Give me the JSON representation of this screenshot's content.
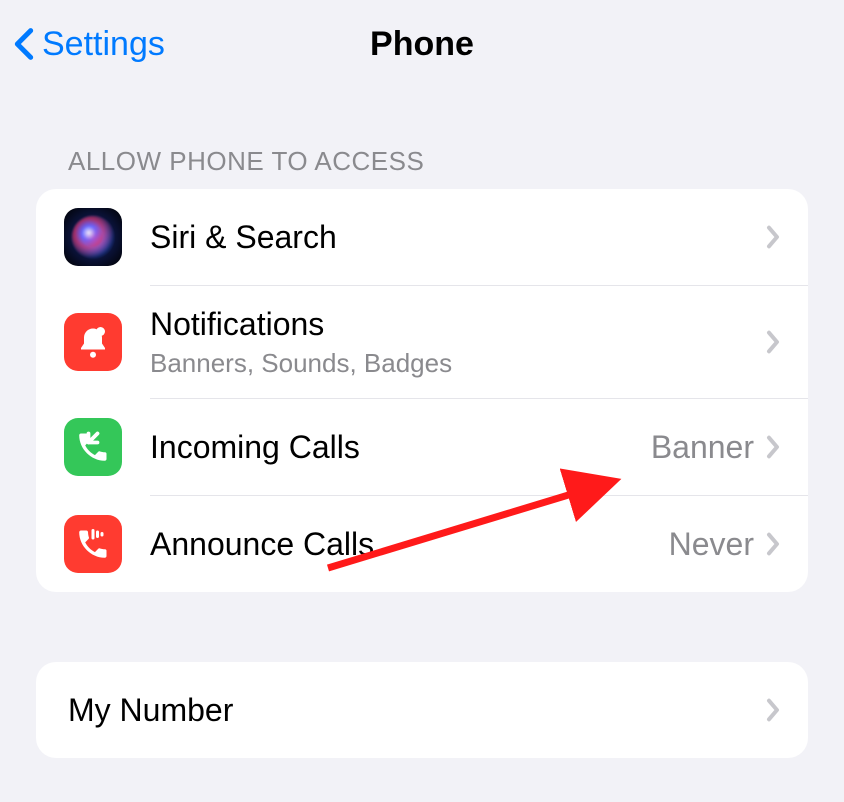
{
  "nav": {
    "back_label": "Settings",
    "title": "Phone"
  },
  "sections": {
    "allow_access": {
      "header": "ALLOW PHONE TO ACCESS",
      "rows": {
        "siri": {
          "label": "Siri & Search"
        },
        "notifications": {
          "label": "Notifications",
          "sublabel": "Banners, Sounds, Badges"
        },
        "incoming": {
          "label": "Incoming Calls",
          "value": "Banner"
        },
        "announce": {
          "label": "Announce Calls",
          "value": "Never"
        }
      }
    },
    "my_number": {
      "rows": {
        "number": {
          "label": "My Number"
        }
      }
    }
  }
}
